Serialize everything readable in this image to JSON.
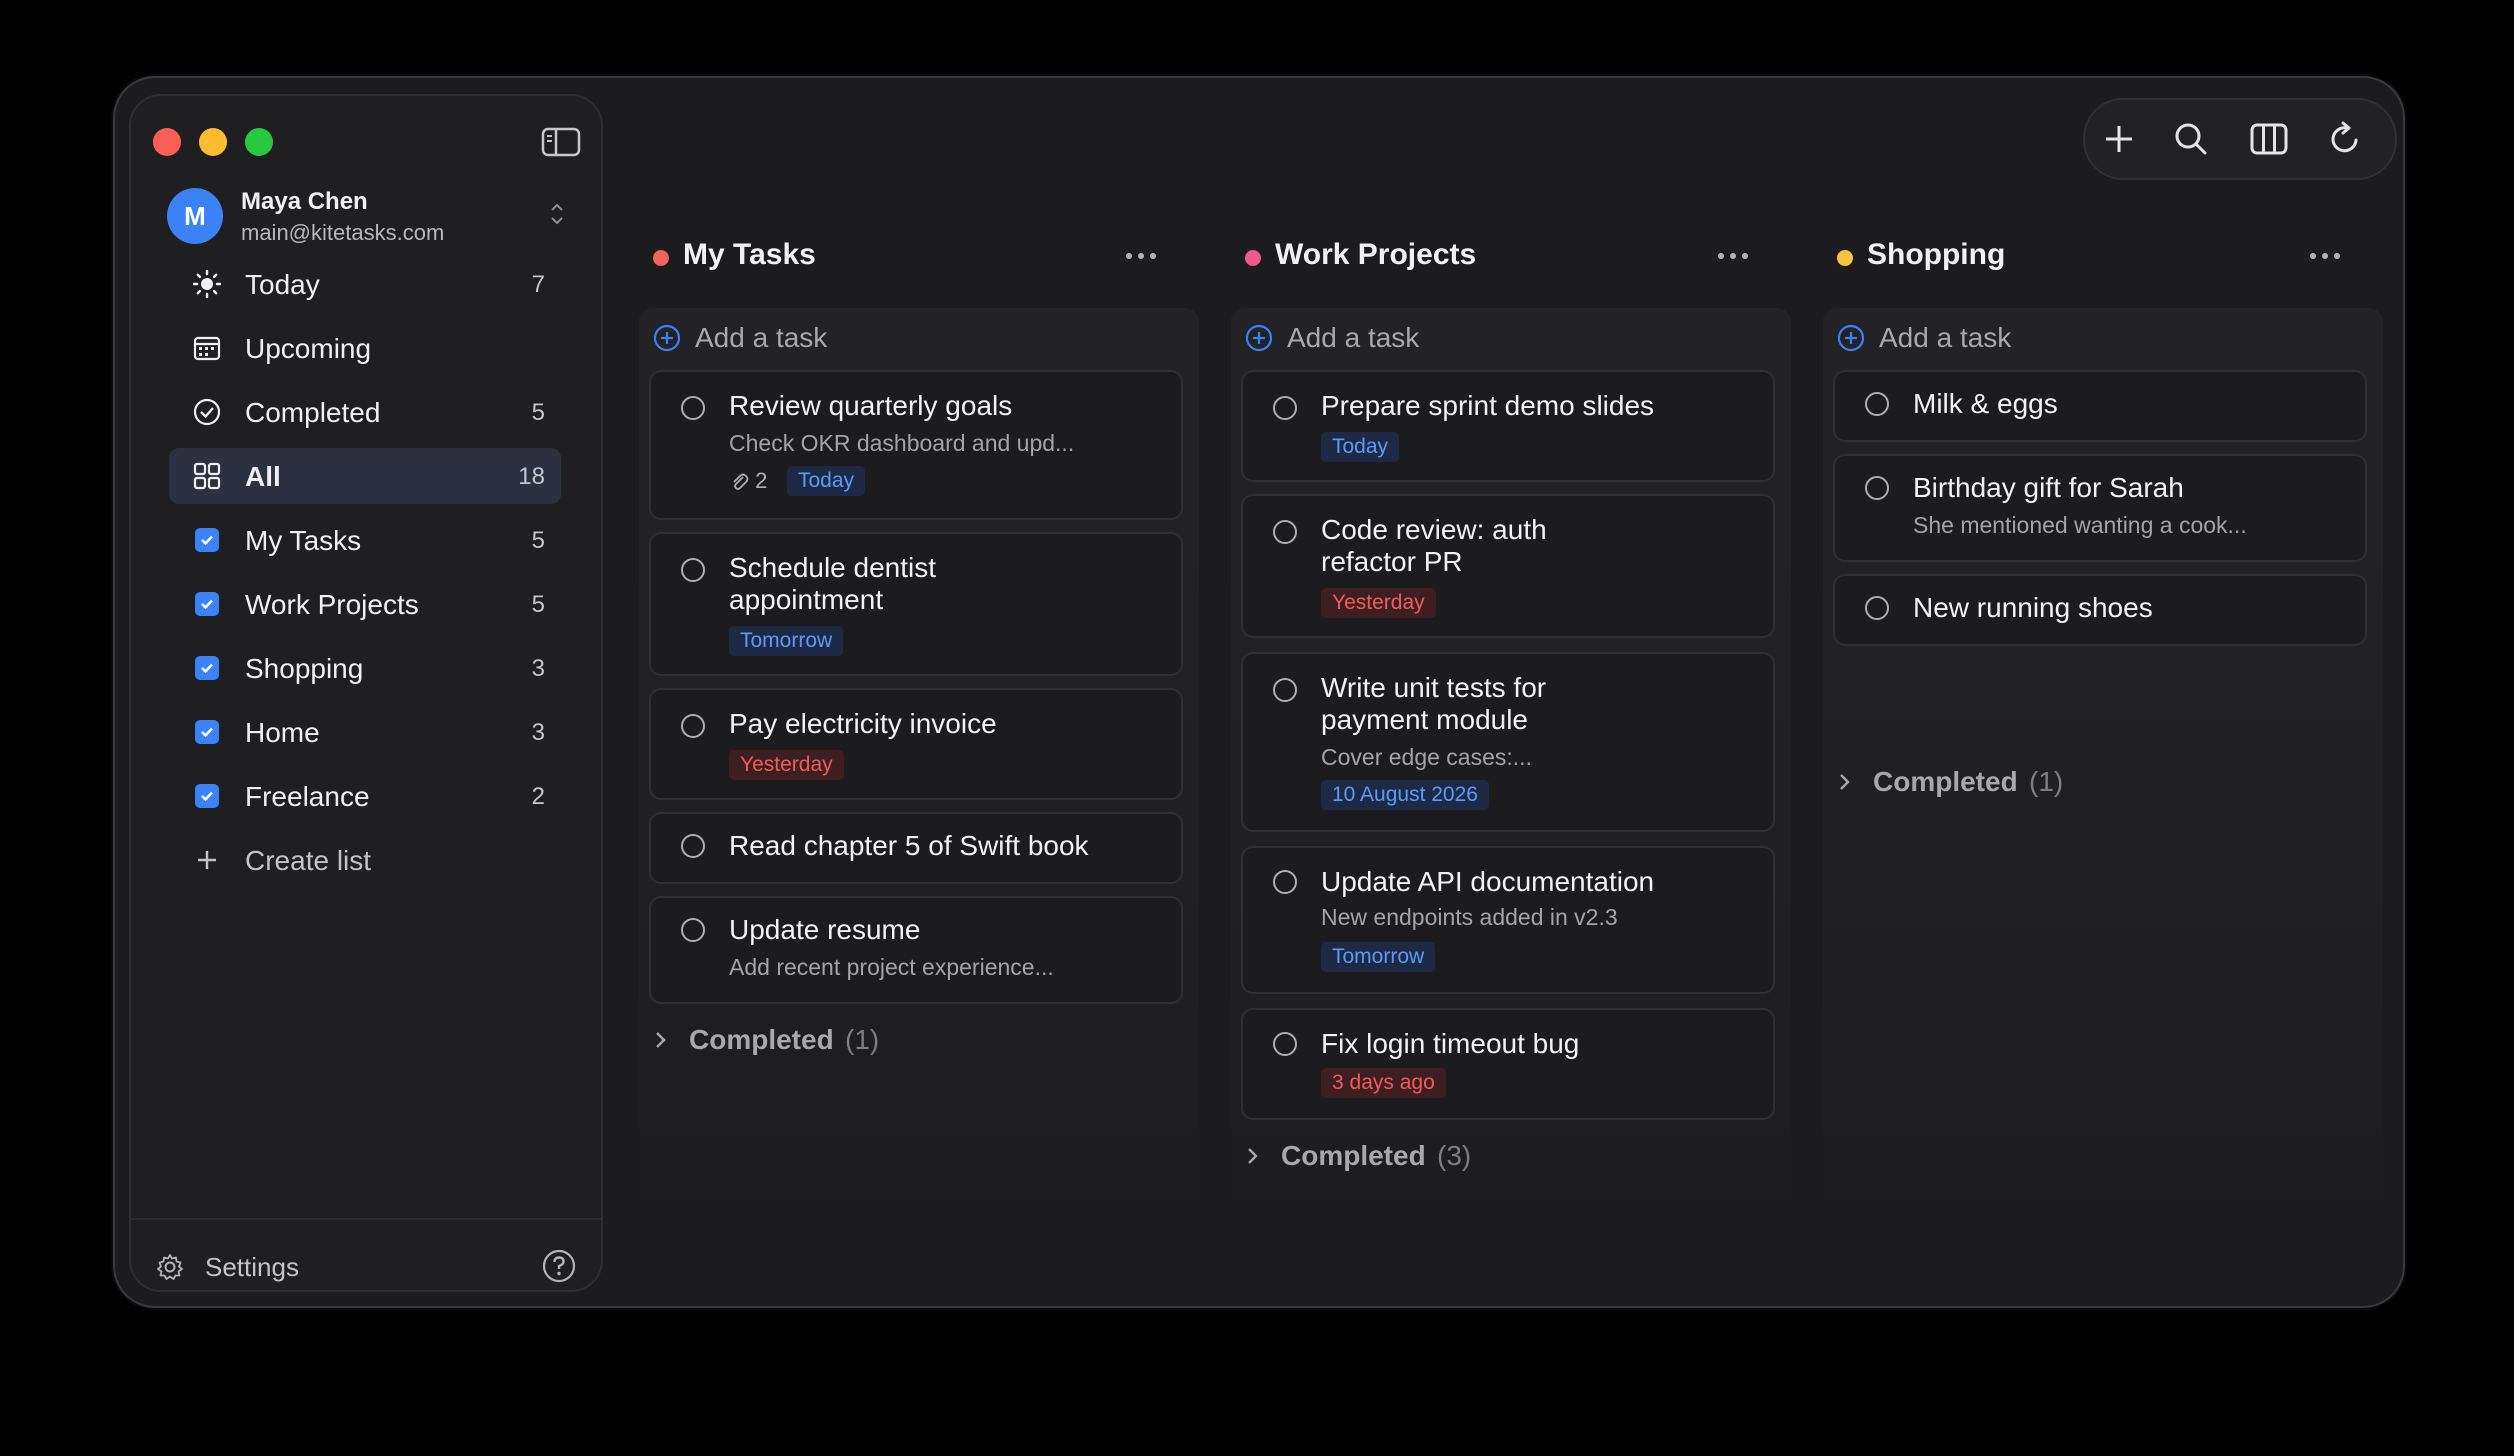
{
  "account": {
    "initial": "M",
    "name": "Maya Chen",
    "email": "main@kitetasks.com"
  },
  "nav": [
    {
      "label": "Today",
      "count": "7",
      "icon": "sun-icon"
    },
    {
      "label": "Upcoming",
      "count": "",
      "icon": "calendar-icon"
    },
    {
      "label": "Completed",
      "count": "5",
      "icon": "check-circle-icon"
    },
    {
      "label": "All",
      "count": "18",
      "icon": "grid-icon",
      "active": true
    },
    {
      "label": "My Tasks",
      "count": "5",
      "icon": "checkbox-icon"
    },
    {
      "label": "Work Projects",
      "count": "5",
      "icon": "checkbox-icon"
    },
    {
      "label": "Shopping",
      "count": "3",
      "icon": "checkbox-icon"
    },
    {
      "label": "Home",
      "count": "3",
      "icon": "checkbox-icon"
    },
    {
      "label": "Freelance",
      "count": "2",
      "icon": "checkbox-icon"
    }
  ],
  "create_list_label": "Create list",
  "settings_label": "Settings",
  "add_task_label": "Add a task",
  "completed_label": "Completed",
  "colors": {
    "accent": "#3b82f6",
    "my_tasks": "#f2645a",
    "work_projects": "#ee5a8a",
    "shopping": "#f5c542"
  },
  "columns": [
    {
      "title": "My Tasks",
      "completed_count": "(1)",
      "tasks": [
        {
          "title": "Review quarterly goals",
          "note": "Check OKR dashboard and upd...",
          "attachments": "2",
          "tag": "Today"
        },
        {
          "title": "Schedule dentist appointment",
          "tag": "Tomorrow"
        },
        {
          "title": "Pay electricity invoice",
          "tag": "Yesterday"
        },
        {
          "title": "Read chapter 5 of Swift book"
        },
        {
          "title": "Update resume",
          "note": "Add recent project experience..."
        }
      ]
    },
    {
      "title": "Work Projects",
      "completed_count": "(3)",
      "tasks": [
        {
          "title": "Prepare sprint demo slides",
          "tag": "Today"
        },
        {
          "title": "Code review: auth refactor PR",
          "tag": "Yesterday"
        },
        {
          "title": "Write unit tests for payment module",
          "note": "Cover edge cases:...",
          "tag": "10 August 2026"
        },
        {
          "title": "Update API documentation",
          "note": "New endpoints added in v2.3",
          "tag": "Tomorrow"
        },
        {
          "title": "Fix login timeout bug",
          "tag": "3 days ago"
        }
      ]
    },
    {
      "title": "Shopping",
      "completed_count": "(1)",
      "tasks": [
        {
          "title": "Milk & eggs"
        },
        {
          "title": "Birthday gift for Sarah",
          "note": "She mentioned wanting a cook..."
        },
        {
          "title": "New running shoes"
        }
      ]
    }
  ]
}
